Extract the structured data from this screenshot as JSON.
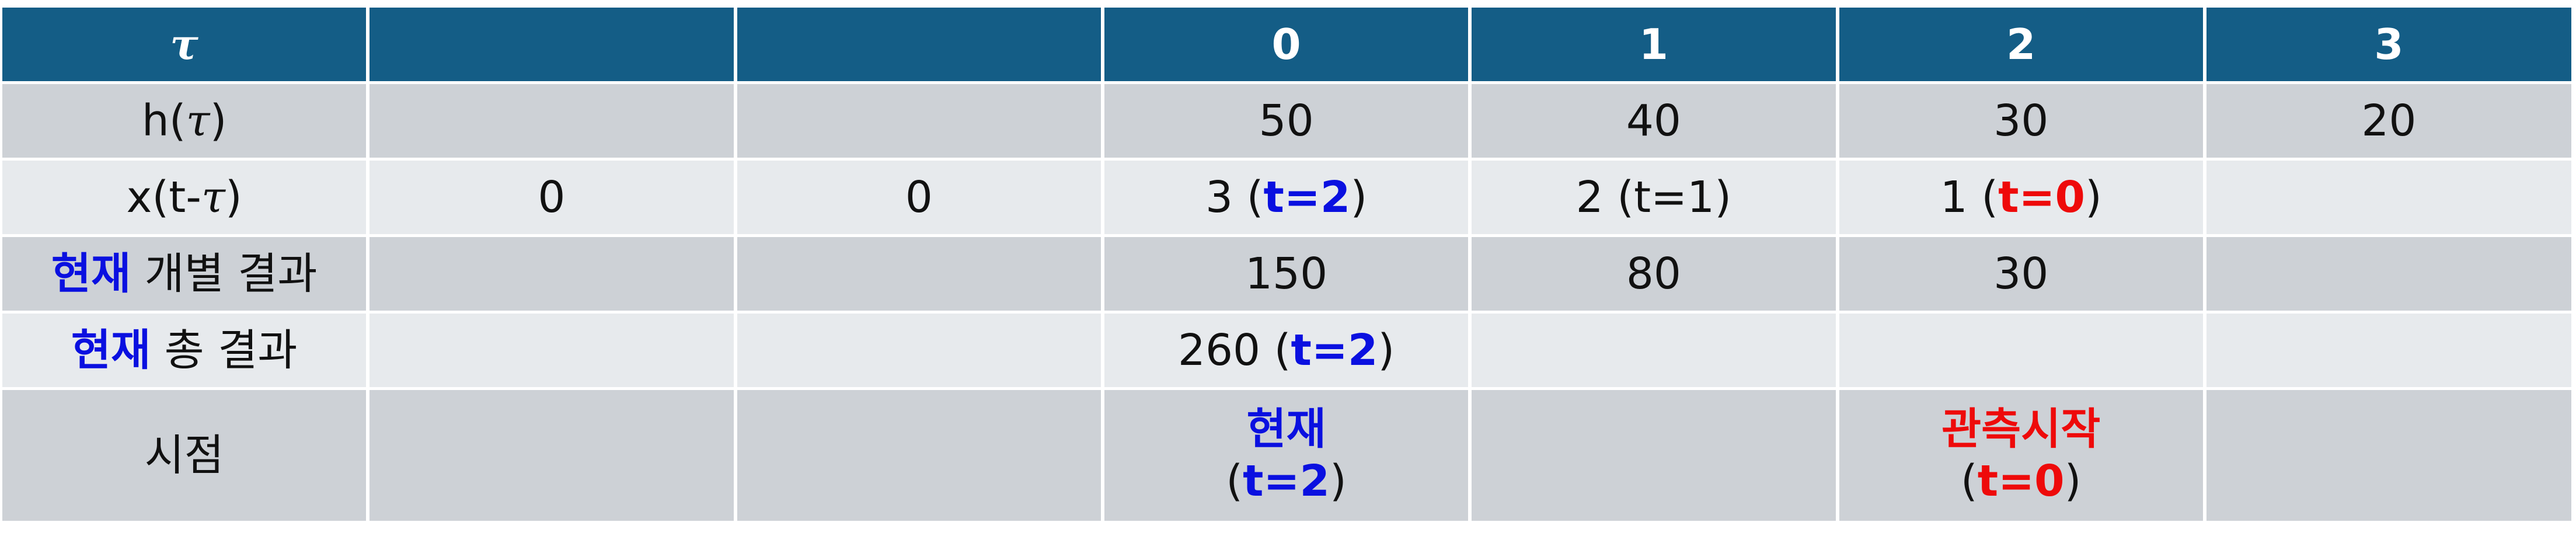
{
  "colors": {
    "header_bg": "#145d86",
    "row_dark": "#cdd1d6",
    "row_light": "#e7eaed",
    "accent_blue": "#0a10e0",
    "accent_red": "#ee0a0a"
  },
  "header": {
    "tau": "τ",
    "cols": [
      "0",
      "1",
      "2",
      "3"
    ]
  },
  "row_h": {
    "label_pre": "h(",
    "label_sym": "τ",
    "label_post": ")",
    "values": [
      "50",
      "40",
      "30",
      "20"
    ]
  },
  "row_x": {
    "label_pre": "x(t-",
    "label_sym": "τ",
    "label_post": ")",
    "c1": "0",
    "c2": "0",
    "c3_pre": "3 (",
    "c3_hl": "t=2",
    "c3_post": ")",
    "c4": "2 (t=1)",
    "c5_pre": "1 (",
    "c5_hl": "t=0",
    "c5_post": ")"
  },
  "row_individual": {
    "label_hl": "현재",
    "label_rest": " 개별 결과",
    "values": [
      "150",
      "80",
      "30"
    ]
  },
  "row_total": {
    "label_hl": "현재",
    "label_rest": " 총 결과",
    "value_pre": "260 (",
    "value_hl": "t=2",
    "value_post": ")"
  },
  "row_time": {
    "label": "시점",
    "now_title": "현재",
    "now_pre": "(",
    "now_hl": "t=2",
    "now_post": ")",
    "start_title": "관측시작",
    "start_pre": "(",
    "start_hl": "t=0",
    "start_post": ")"
  }
}
